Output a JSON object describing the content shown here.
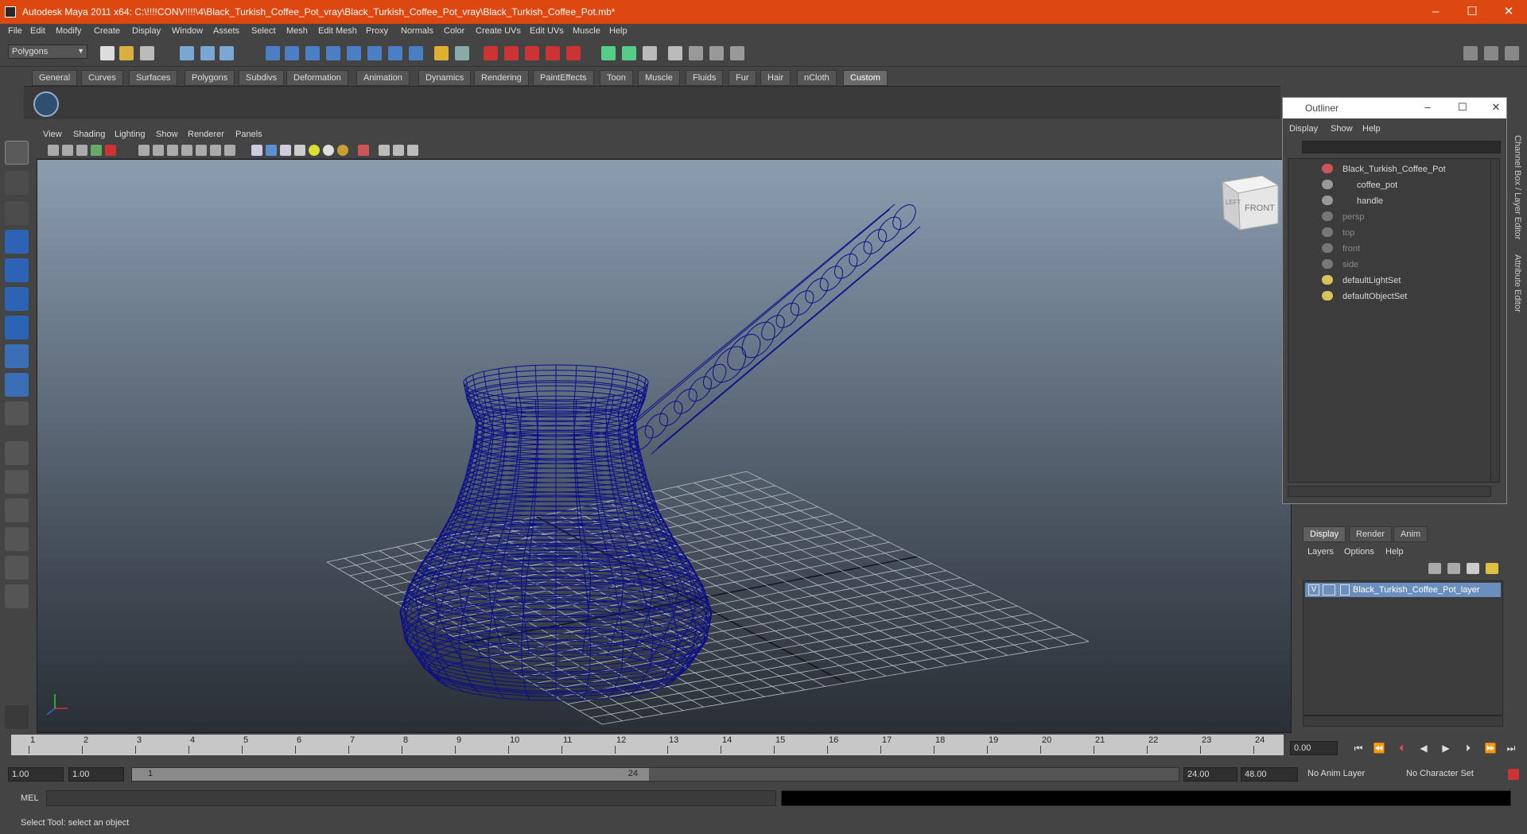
{
  "window": {
    "title": "Autodesk Maya 2011 x64: C:\\!!!!CONV!!!!\\4\\Black_Turkish_Coffee_Pot_vray\\Black_Turkish_Coffee_Pot_vray\\Black_Turkish_Coffee_Pot.mb*",
    "minimize": "–",
    "maximize": "☐",
    "close": "✕"
  },
  "menu": [
    "File",
    "Edit",
    "Modify",
    "Create",
    "Display",
    "Window",
    "Assets",
    "Select",
    "Mesh",
    "Edit Mesh",
    "Proxy",
    "Normals",
    "Color",
    "Create UVs",
    "Edit UVs",
    "Muscle",
    "Help"
  ],
  "mode_dropdown": "Polygons",
  "shelf_tabs": [
    "General",
    "Curves",
    "Surfaces",
    "Polygons",
    "Subdivs",
    "Deformation",
    "Animation",
    "Dynamics",
    "Rendering",
    "PaintEffects",
    "Toon",
    "Muscle",
    "Fluids",
    "Fur",
    "Hair",
    "nCloth",
    "Custom"
  ],
  "active_shelf": "Custom",
  "panel_menu": [
    "View",
    "Shading",
    "Lighting",
    "Show",
    "Renderer",
    "Panels"
  ],
  "viewcube": {
    "front": "FRONT",
    "left": "LEFT"
  },
  "outliner": {
    "title": "Outliner",
    "menu": [
      "Display",
      "Show",
      "Help"
    ],
    "items": [
      {
        "label": "Black_Turkish_Coffee_Pot",
        "dim": false
      },
      {
        "label": "coffee_pot",
        "dim": false
      },
      {
        "label": "handle",
        "dim": false
      },
      {
        "label": "persp",
        "dim": true
      },
      {
        "label": "top",
        "dim": true
      },
      {
        "label": "front",
        "dim": true
      },
      {
        "label": "side",
        "dim": true
      },
      {
        "label": "defaultLightSet",
        "dim": false
      },
      {
        "label": "defaultObjectSet",
        "dim": false
      }
    ]
  },
  "side_tabs": [
    "Channel Box / Layer Editor",
    "Attribute Editor"
  ],
  "layer_editor": {
    "tabs": [
      "Display",
      "Render",
      "Anim"
    ],
    "active_tab": "Display",
    "menu": [
      "Layers",
      "Options",
      "Help"
    ],
    "layers": [
      {
        "visible": "V",
        "name": "Black_Turkish_Coffee_Pot_layer"
      }
    ]
  },
  "time_slider": {
    "ticks": [
      "1",
      "2",
      "3",
      "4",
      "5",
      "6",
      "7",
      "8",
      "9",
      "10",
      "11",
      "12",
      "13",
      "14",
      "15",
      "16",
      "17",
      "18",
      "19",
      "20",
      "21",
      "22",
      "23",
      "24"
    ],
    "current_time": "0.00"
  },
  "range": {
    "start": "1.00",
    "playback_start": "1.00",
    "thumb_start": "1",
    "thumb_end": "24",
    "playback_end": "24.00",
    "end": "48.00",
    "anim_layer": "No Anim Layer",
    "character_set": "No Character Set"
  },
  "command_line": {
    "label": "MEL"
  },
  "help_line": "Select Tool: select an object",
  "colors": {
    "title_bar": "#dd4710",
    "wireframe": "#0a0f8a",
    "layer_highlight": "#6a8fbf"
  }
}
